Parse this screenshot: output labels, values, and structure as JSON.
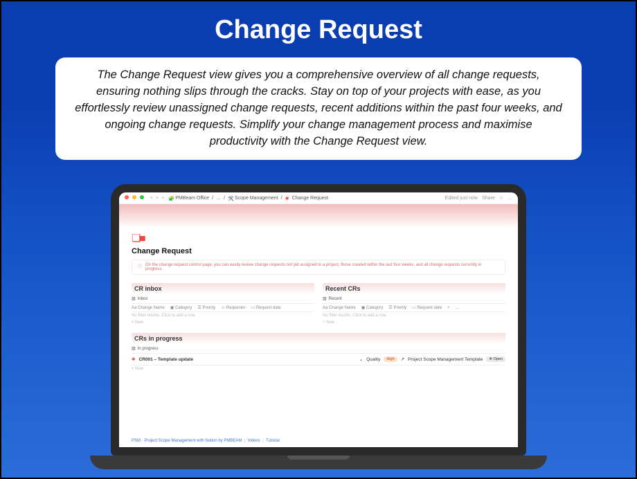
{
  "hero": {
    "title": "Change Request",
    "description": "The Change Request view gives you a comprehensive overview of all change requests, ensuring nothing slips through the cracks. Stay on top of your projects with ease, as you effortlessly review unassigned change requests, recent additions within the past four weeks, and ongoing change requests. Simplify your change management process and maximise productivity with the Change Request view."
  },
  "colors": {
    "accent_red": "#e84b3c"
  },
  "topbar": {
    "nav": [
      "<",
      ">",
      "+"
    ],
    "crumbs": [
      "PMBeam Office",
      "…",
      "Scope Management",
      "Change Request"
    ],
    "edited": "Edited just now",
    "share": "Share",
    "more": "…"
  },
  "page": {
    "title": "Change Request",
    "alert": "On the change request control page, you can easily review change requests not yet assigned to a project, those created within the last four weeks, and all change requests currently in progress."
  },
  "cr_inbox": {
    "title": "CR inbox",
    "view": "Inbox",
    "columns": [
      "Aa Change Name",
      "Category",
      "Priority",
      "Requester",
      "Request date"
    ],
    "empty": "No filter results. Click to add a row.",
    "new": "+ New"
  },
  "recent": {
    "title": "Recent CRs",
    "view": "Recent",
    "columns": [
      "Aa Change Name",
      "Category",
      "Priority",
      "Request date",
      "+",
      "…"
    ],
    "empty": "No filter results. Click to add a row.",
    "new": "+ New"
  },
  "in_progress": {
    "title": "CRs in progress",
    "view": "In progress",
    "row": {
      "name": "CR001 – Template update",
      "category_label": "Quality",
      "priority": "High",
      "project_label": "Project Scope Management Template",
      "status": "Open"
    },
    "new": "+ New"
  },
  "footer": [
    "PSM · Project Scope Management with Notion by PMBEAM",
    "Videos",
    "Tutorial"
  ]
}
